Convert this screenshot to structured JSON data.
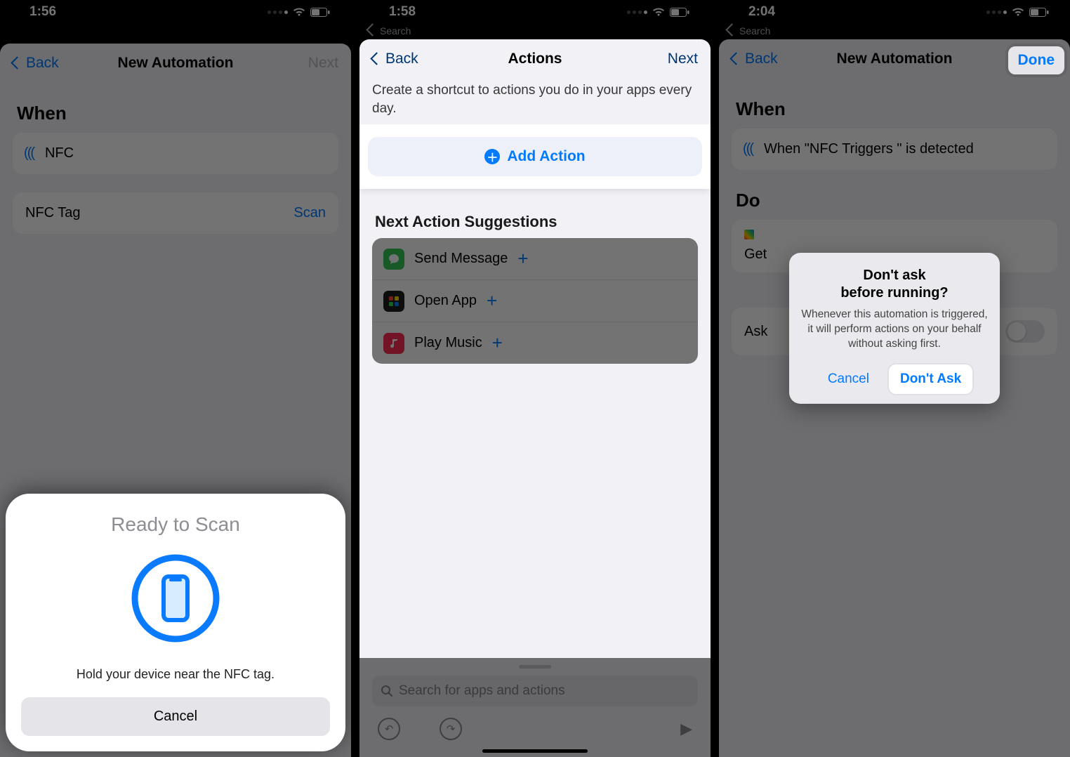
{
  "screen1": {
    "time": "1:56",
    "nav": {
      "back": "Back",
      "title": "New Automation",
      "next": "Next"
    },
    "when_header": "When",
    "nfc_row_label": "NFC",
    "nfc_tag_label": "NFC Tag",
    "scan_link": "Scan",
    "nfc_sheet": {
      "title": "Ready to Scan",
      "message": "Hold your device near the NFC tag.",
      "cancel": "Cancel"
    }
  },
  "screen2": {
    "time": "1:58",
    "breadcrumb": "Search",
    "nav": {
      "back": "Back",
      "title": "Actions",
      "next": "Next"
    },
    "intro": "Create a shortcut to actions you do in your apps every day.",
    "add_action": "Add Action",
    "suggestions_header": "Next Action Suggestions",
    "suggestions": [
      {
        "label": "Send Message",
        "icon_bg": "#34c759"
      },
      {
        "label": "Open App",
        "icon_bg": "#5856d6"
      },
      {
        "label": "Play Music",
        "icon_bg": "#ff2d55"
      }
    ],
    "search_placeholder": "Search for apps and actions"
  },
  "screen3": {
    "time": "2:04",
    "breadcrumb": "Search",
    "nav": {
      "back": "Back",
      "title": "New Automation",
      "done": "Done"
    },
    "when_header": "When",
    "when_text": "When \"NFC Triggers \" is detected",
    "do_header": "Do",
    "do_action_label": "Get",
    "ask_label": "Ask",
    "alert": {
      "title_line1": "Don't ask",
      "title_line2": "before running?",
      "message": "Whenever this automation is triggered, it will perform actions on your behalf without asking first.",
      "cancel": "Cancel",
      "confirm": "Don't Ask"
    }
  }
}
